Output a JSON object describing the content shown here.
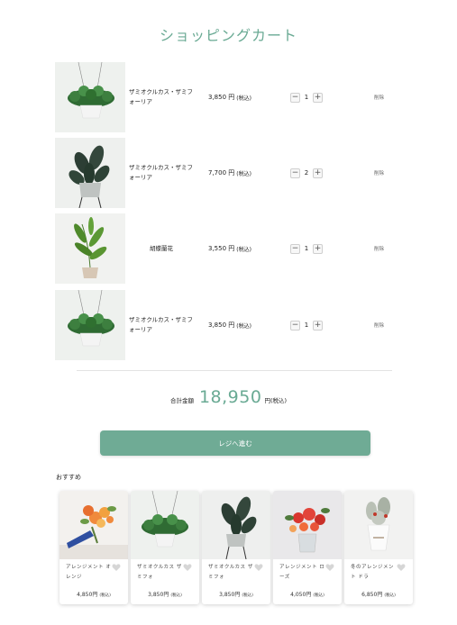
{
  "page": {
    "title": "ショッピングカート"
  },
  "cart": {
    "items": [
      {
        "name": "ザミオクルカス・ザミフォーリア",
        "price": "3,850 円",
        "tax": "(税込)",
        "qty": "1",
        "remove": "削除"
      },
      {
        "name": "ザミオクルカス・ザミフォーリア",
        "price": "7,700 円",
        "tax": "(税込)",
        "qty": "2",
        "remove": "削除"
      },
      {
        "name": "胡蝶蘭花",
        "price": "3,550 円",
        "tax": "(税込)",
        "qty": "1",
        "remove": "削除"
      },
      {
        "name": "ザミオクルカス・ザミフォーリア",
        "price": "3,850 円",
        "tax": "(税込)",
        "qty": "1",
        "remove": "削除"
      }
    ],
    "minus": "−",
    "plus": "+"
  },
  "total": {
    "label": "合計金額",
    "value": "18,950",
    "unit": "円(税込)"
  },
  "checkout": {
    "label": "レジへ進む"
  },
  "recommend": {
    "title": "おすすめ",
    "items": [
      {
        "name": "アレンジメント オレンジ",
        "price": "4,850円",
        "tax": "(税込)"
      },
      {
        "name": "ザミオクルカス ザミフォ",
        "price": "3,850円",
        "tax": "(税込)"
      },
      {
        "name": "ザミオクルカス ザミフォ",
        "price": "3,850円",
        "tax": "(税込)"
      },
      {
        "name": "アレンジメント ローズ",
        "price": "4,050円",
        "tax": "(税込)"
      },
      {
        "name": "冬のアレンジメント ドラ",
        "price": "6,850円",
        "tax": "(税込)"
      }
    ]
  },
  "colors": {
    "accent": "#6fab95",
    "title": "#6aaa94"
  },
  "icons": {
    "heart": "heart-icon"
  }
}
